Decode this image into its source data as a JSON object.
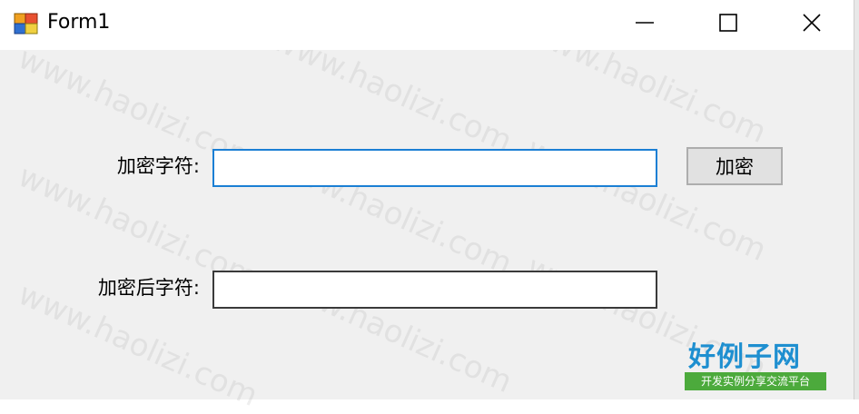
{
  "window": {
    "title": "Form1",
    "icon": "winforms-app-icon",
    "controls": {
      "minimize": "minimize-icon",
      "maximize": "maximize-icon",
      "close": "close-icon"
    }
  },
  "form": {
    "plain_label": "加密字符:",
    "plain_value": "",
    "encrypt_button": "加密",
    "cipher_label": "加密后字符:",
    "cipher_value": ""
  },
  "watermark": {
    "text": "www.haolizi.com"
  },
  "logo": {
    "main": "好例子网",
    "sub": "开发实例分享交流平台"
  },
  "colors": {
    "title_bg": "#ffffff",
    "form_bg": "#f0f0f0",
    "focus_border": "#1b7fd4",
    "button_bg": "#e1e1e1",
    "logo_blue": "#1e8fd0",
    "logo_green": "#4caa3c"
  }
}
